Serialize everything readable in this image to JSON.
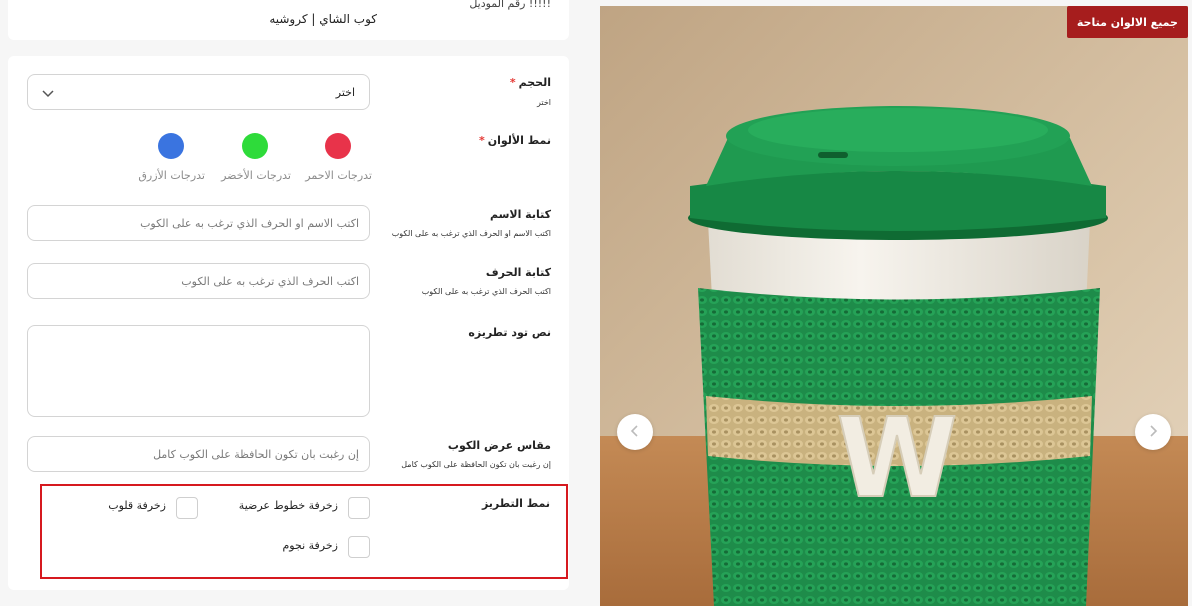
{
  "top": {
    "model_label": "!!!!! رقم الموديل",
    "product_name": "كوب الشاي | كروشيه"
  },
  "size": {
    "label": "الحجم",
    "required_mark": "*",
    "hint": "اختر",
    "select_value": "اختر"
  },
  "colors": {
    "label": "نمط الألوان",
    "required_mark": "*",
    "swatches": [
      {
        "label": "تدرجات الاحمر",
        "color": "#e8334a"
      },
      {
        "label": "تدرجات الأخضر",
        "color": "#2edb3a"
      },
      {
        "label": "تدرجات الأزرق",
        "color": "#3a74e0"
      }
    ]
  },
  "name_writing": {
    "label": "كتابة الاسم",
    "hint": "اكتب الاسم او الحرف الذي ترغب به على الكوب",
    "placeholder": "اكتب الاسم او الحرف الذي ترغب به على الكوب"
  },
  "letter_writing": {
    "label": "كتابة الحرف",
    "hint": "اكتب الحرف الذي ترغب به على الكوب",
    "placeholder": "اكتب الحرف الذي ترغب به على الكوب"
  },
  "embroidery_text": {
    "label": "نص تود تطريزه"
  },
  "cup_width": {
    "label": "مقاس عرض الكوب",
    "hint": "إن رغبت بان تكون الحافظة على الكوب كامل",
    "placeholder": "إن رغبت بان تكون الحافظة على الكوب كامل"
  },
  "embroidery_style": {
    "label": "نمط التطريز",
    "options": {
      "stripes": "زخرفة خطوط عرضية",
      "hearts": "زخرفة قلوب",
      "stars": "زخرفة نجوم"
    }
  },
  "gallery": {
    "badge": "جميع الالوان متاحة",
    "prev_icon": "chevron-left-icon",
    "next_icon": "chevron-right-icon",
    "cup_letter": "W"
  },
  "theme": {
    "accent_red": "#a61d1d",
    "highlight_red": "#d6191f",
    "cup_green": "#1e8c4a"
  }
}
